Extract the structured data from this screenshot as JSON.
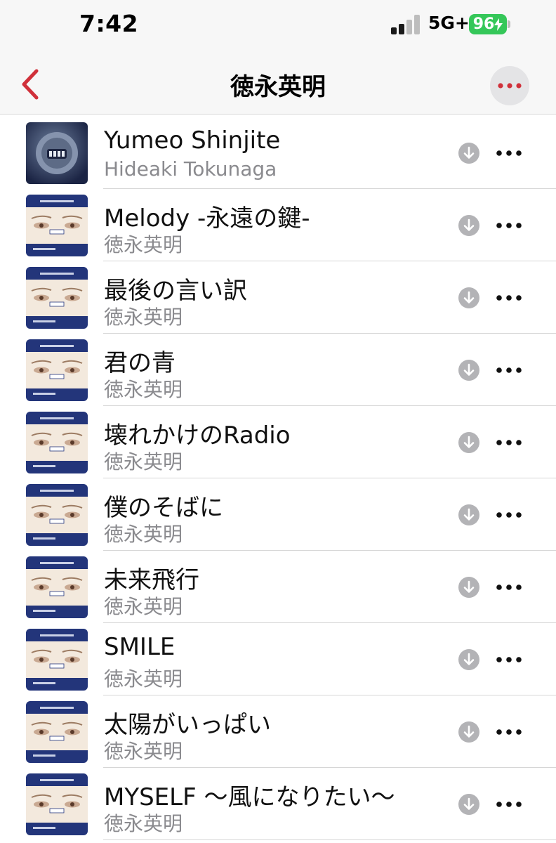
{
  "status_bar": {
    "time": "7:42",
    "network": "5G+",
    "battery": "96"
  },
  "nav": {
    "back_icon": "chevron-left-icon",
    "title": "徳永英明",
    "more_icon": "ellipsis-icon",
    "accent_color": "#d0303a"
  },
  "tracks": [
    {
      "title": "Yumeo Shinjite",
      "artist": "Hideaki Tokunaga",
      "art": "art-moon"
    },
    {
      "title": "Melody -永遠の鍵-",
      "artist": "徳永英明",
      "art": "art-ballade"
    },
    {
      "title": "最後の言い訳",
      "artist": "徳永英明",
      "art": "art-ballade"
    },
    {
      "title": "君の青",
      "artist": "徳永英明",
      "art": "art-ballade"
    },
    {
      "title": "壊れかけのRadio",
      "artist": "徳永英明",
      "art": "art-ballade"
    },
    {
      "title": "僕のそばに",
      "artist": "徳永英明",
      "art": "art-ballade"
    },
    {
      "title": "未来飛行",
      "artist": "徳永英明",
      "art": "art-ballade"
    },
    {
      "title": "SMILE",
      "artist": "徳永英明",
      "art": "art-ballade"
    },
    {
      "title": "太陽がいっぱい",
      "artist": "徳永英明",
      "art": "art-ballade"
    },
    {
      "title": "MYSELF ～風になりたい～",
      "artist": "徳永英明",
      "art": "art-ballade"
    }
  ]
}
